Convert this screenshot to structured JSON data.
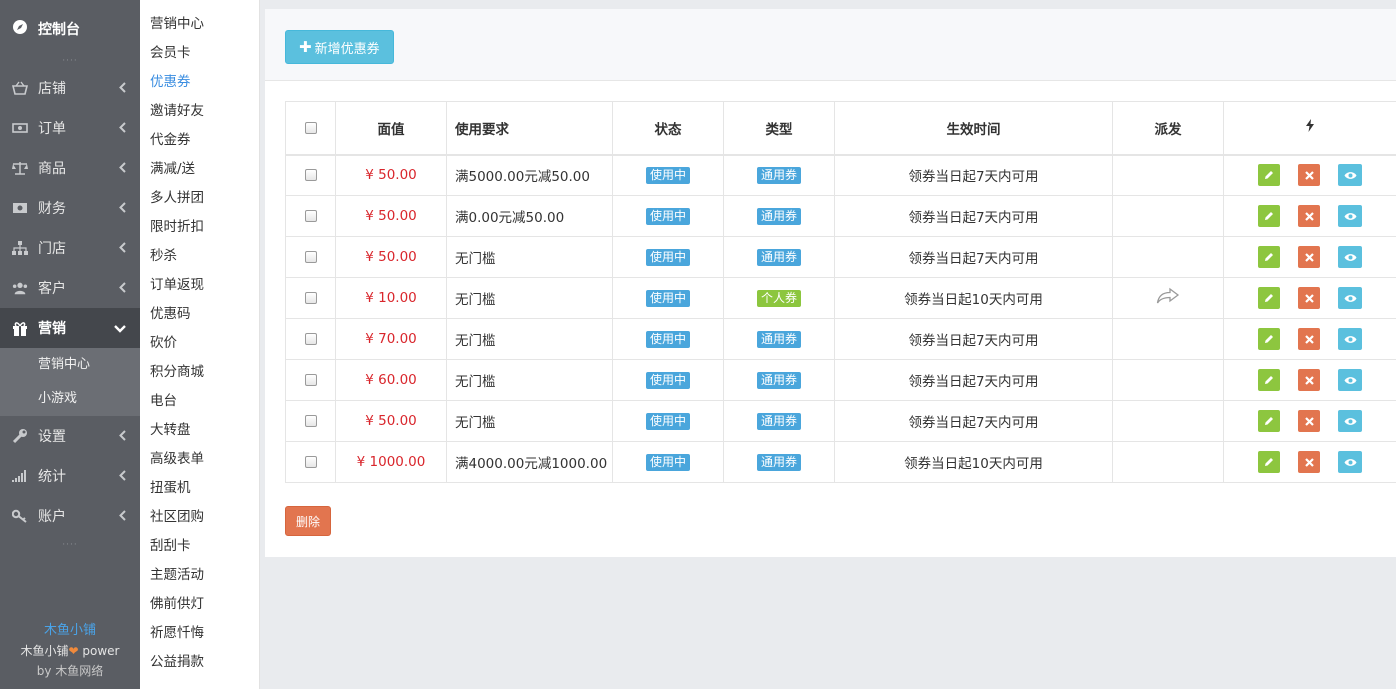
{
  "sidebar": {
    "title": "控制台",
    "dots_top": "····",
    "items": [
      {
        "label": "店铺",
        "icon": "basket-icon"
      },
      {
        "label": "订单",
        "icon": "money-icon"
      },
      {
        "label": "商品",
        "icon": "scale-icon"
      },
      {
        "label": "财务",
        "icon": "cash-icon"
      },
      {
        "label": "门店",
        "icon": "sitemap-icon"
      },
      {
        "label": "客户",
        "icon": "users-icon"
      },
      {
        "label": "营销",
        "icon": "gift-icon"
      },
      {
        "label": "设置",
        "icon": "wrench-icon"
      },
      {
        "label": "统计",
        "icon": "signal-icon"
      },
      {
        "label": "账户",
        "icon": "key-icon"
      }
    ],
    "sub_items": [
      "营销中心",
      "小游戏"
    ],
    "dots_bottom": "····",
    "footer": {
      "brand": "木鱼小铺",
      "power_prefix": "木鱼小铺",
      "power_suffix": " power",
      "by": "by 木鱼网络"
    }
  },
  "submenu": [
    "营销中心",
    "会员卡",
    "优惠券",
    "邀请好友",
    "代金券",
    "满减/送",
    "多人拼团",
    "限时折扣",
    "秒杀",
    "订单返现",
    "优惠码",
    "砍价",
    "积分商城",
    "电台",
    "大转盘",
    "高级表单",
    "扭蛋机",
    "社区团购",
    "刮刮卡",
    "主题活动",
    "佛前供灯",
    "祈愿忏悔",
    "公益捐款"
  ],
  "submenu_current": 2,
  "toolbar": {
    "add_label": "新增优惠券",
    "add_icon": "plus-icon"
  },
  "table": {
    "headers": [
      "面值",
      "使用要求",
      "状态",
      "类型",
      "生效时间",
      "派发"
    ],
    "action_header_icon": "bolt-icon",
    "rows": [
      {
        "value": "¥ 50.00",
        "req": "满5000.00元减50.00",
        "status": "使用中",
        "type": "通用券",
        "time": "领券当日起7天内可用",
        "dispatch": ""
      },
      {
        "value": "¥ 50.00",
        "req": "满0.00元减50.00",
        "status": "使用中",
        "type": "通用券",
        "time": "领券当日起7天内可用",
        "dispatch": ""
      },
      {
        "value": "¥ 50.00",
        "req": "无门槛",
        "status": "使用中",
        "type": "通用券",
        "time": "领券当日起7天内可用",
        "dispatch": ""
      },
      {
        "value": "¥ 10.00",
        "req": "无门槛",
        "status": "使用中",
        "type": "个人券",
        "time": "领券当日起10天内可用",
        "dispatch": "share-icon"
      },
      {
        "value": "¥ 70.00",
        "req": "无门槛",
        "status": "使用中",
        "type": "通用券",
        "time": "领券当日起7天内可用",
        "dispatch": ""
      },
      {
        "value": "¥ 60.00",
        "req": "无门槛",
        "status": "使用中",
        "type": "通用券",
        "time": "领券当日起7天内可用",
        "dispatch": ""
      },
      {
        "value": "¥ 50.00",
        "req": "无门槛",
        "status": "使用中",
        "type": "通用券",
        "time": "领券当日起7天内可用",
        "dispatch": ""
      },
      {
        "value": "¥ 1000.00",
        "req": "满4000.00元减1000.00",
        "status": "使用中",
        "type": "通用券",
        "time": "领券当日起10天内可用",
        "dispatch": ""
      }
    ]
  },
  "delete_label": "删除",
  "colors": {
    "sidebar_bg": "#5a5d63",
    "price": "#d9262c",
    "badge_blue": "#4aa6dc",
    "badge_green": "#8cc63e",
    "edit": "#8dc63f",
    "delete": "#e2754f",
    "view": "#5bc0de"
  }
}
